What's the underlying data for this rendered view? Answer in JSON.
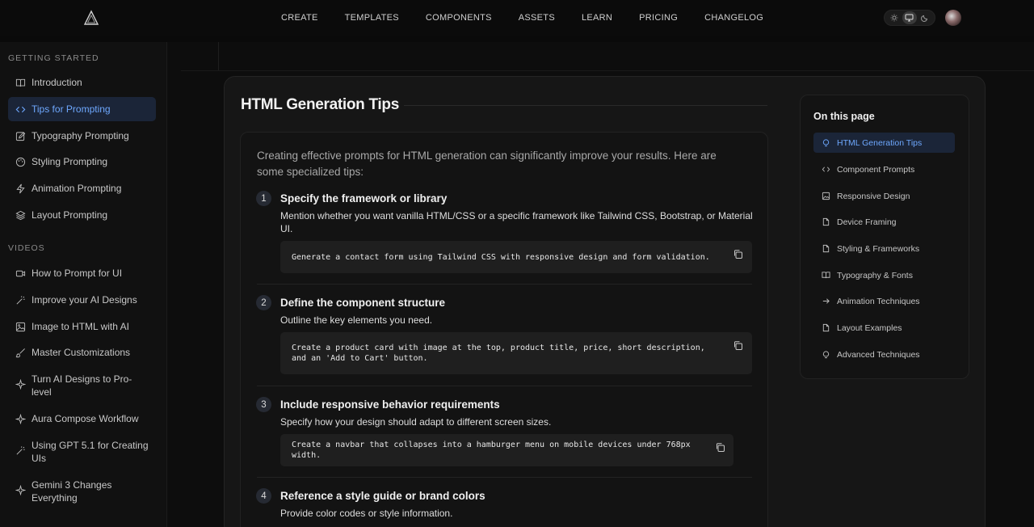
{
  "topbar": {
    "logo_icon": "aura-logo-icon",
    "nav": [
      "CREATE",
      "TEMPLATES",
      "COMPONENTS",
      "ASSETS",
      "LEARN",
      "PRICING",
      "CHANGELOG"
    ],
    "theme_modes": [
      "sun-icon",
      "monitor-icon",
      "moon-icon"
    ],
    "theme_active": "monitor-icon"
  },
  "sidebar": {
    "section1": "GETTING STARTED",
    "items1": [
      {
        "label": "Introduction",
        "icon": "book-icon"
      },
      {
        "label": "Tips for Prompting",
        "icon": "code-icon",
        "active": true
      },
      {
        "label": "Typography Prompting",
        "icon": "edit-icon"
      },
      {
        "label": "Styling Prompting",
        "icon": "palette-icon"
      },
      {
        "label": "Animation Prompting",
        "icon": "zap-icon"
      },
      {
        "label": "Layout Prompting",
        "icon": "layers-icon"
      }
    ],
    "section2": "VIDEOS",
    "items2": [
      {
        "label": "How to Prompt for UI",
        "icon": "video-icon"
      },
      {
        "label": "Improve your AI Designs",
        "icon": "wand-icon"
      },
      {
        "label": "Image to HTML with AI",
        "icon": "image-icon"
      },
      {
        "label": "Master Customizations",
        "icon": "brush-icon"
      },
      {
        "label": "Turn AI Designs to Pro-level",
        "icon": "sparkle-icon"
      },
      {
        "label": "Aura Compose Workflow",
        "icon": "sparkle-icon"
      },
      {
        "label": "Using GPT 5.1 for Creating UIs",
        "icon": "wand-icon"
      },
      {
        "label": "Gemini 3 Changes Everything",
        "icon": "sparkle-icon"
      }
    ]
  },
  "main": {
    "title": "HTML Generation Tips",
    "intro": "Creating effective prompts for HTML generation can significantly improve your results. Here are some specialized tips:",
    "steps": [
      {
        "num": "1",
        "title": "Specify the framework or library",
        "desc": "Mention whether you want vanilla HTML/CSS or a specific framework like Tailwind CSS, Bootstrap, or Material UI.",
        "code": "Generate a contact form using Tailwind CSS with responsive design and form validation."
      },
      {
        "num": "2",
        "title": "Define the component structure",
        "desc": "Outline the key elements you need.",
        "code": "Create a product card with image at the top, product title, price, short description, and an 'Add to Cart' button."
      },
      {
        "num": "3",
        "title": "Include responsive behavior requirements",
        "desc": "Specify how your design should adapt to different screen sizes.",
        "code": "Create a navbar that collapses into a hamburger menu on mobile devices under 768px width."
      },
      {
        "num": "4",
        "title": "Reference a style guide or brand colors",
        "desc": "Provide color codes or style information."
      }
    ]
  },
  "toc": {
    "title": "On this page",
    "items": [
      {
        "label": "HTML Generation Tips",
        "icon": "lightbulb-icon",
        "active": true
      },
      {
        "label": "Component Prompts",
        "icon": "code-icon"
      },
      {
        "label": "Responsive Design",
        "icon": "image-icon"
      },
      {
        "label": "Device Framing",
        "icon": "file-icon"
      },
      {
        "label": "Styling & Frameworks",
        "icon": "file-icon"
      },
      {
        "label": "Typography & Fonts",
        "icon": "book-icon"
      },
      {
        "label": "Animation Techniques",
        "icon": "arrow-right-icon"
      },
      {
        "label": "Layout Examples",
        "icon": "file-icon"
      },
      {
        "label": "Advanced Techniques",
        "icon": "lightbulb-icon"
      }
    ]
  },
  "colors": {
    "accent": "#6ea8fe",
    "active_bg": "#1b2538",
    "bg": "#0a0a0a",
    "panel": "#161616"
  }
}
